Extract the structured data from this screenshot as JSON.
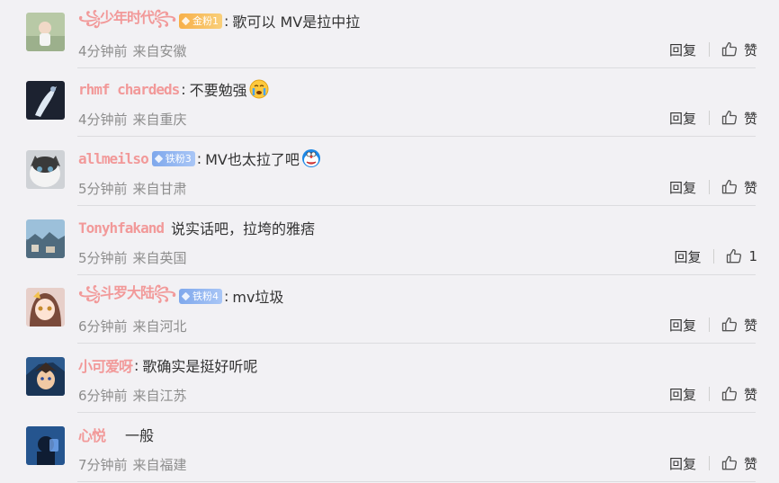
{
  "comments": [
    {
      "username": "꧁少年时代꧂",
      "badge": {
        "text": "金粉1",
        "kind": "gold"
      },
      "text": "歌可以 MV是拉中拉",
      "emoji": "",
      "time": "4分钟前",
      "location": "来自安徽",
      "reply_label": "回复",
      "like_label": "赞"
    },
    {
      "username": "rhmf chardeds",
      "badge": null,
      "text": "不要勉强",
      "emoji": "crying-face",
      "time": "4分钟前",
      "location": "来自重庆",
      "reply_label": "回复",
      "like_label": "赞"
    },
    {
      "username": "allmeilso",
      "badge": {
        "text": "铁粉3",
        "kind": "iron"
      },
      "text": "MV也太拉了吧",
      "emoji": "doraemon-face",
      "time": "5分钟前",
      "location": "来自甘肃",
      "reply_label": "回复",
      "like_label": "赞"
    },
    {
      "username": "Tonyhfakand",
      "badge": null,
      "text": "说实话吧，拉垮的雅痞",
      "emoji": "",
      "time": "5分钟前",
      "location": "来自英国",
      "reply_label": "回复",
      "like_label": "1"
    },
    {
      "username": "꧁斗罗大陆꧂",
      "badge": {
        "text": "铁粉4",
        "kind": "iron"
      },
      "text": "mv垃圾",
      "emoji": "",
      "time": "6分钟前",
      "location": "来自河北",
      "reply_label": "回复",
      "like_label": "赞"
    },
    {
      "username": "小可爱呀",
      "badge": null,
      "text": "歌确实是挺好听呢",
      "emoji": "",
      "time": "6分钟前",
      "location": "来自江苏",
      "reply_label": "回复",
      "like_label": "赞"
    },
    {
      "username": "心悦",
      "badge": null,
      "text": "一般",
      "emoji": "",
      "time": "7分钟前",
      "location": "来自福建",
      "reply_label": "回复",
      "like_label": "赞"
    }
  ]
}
